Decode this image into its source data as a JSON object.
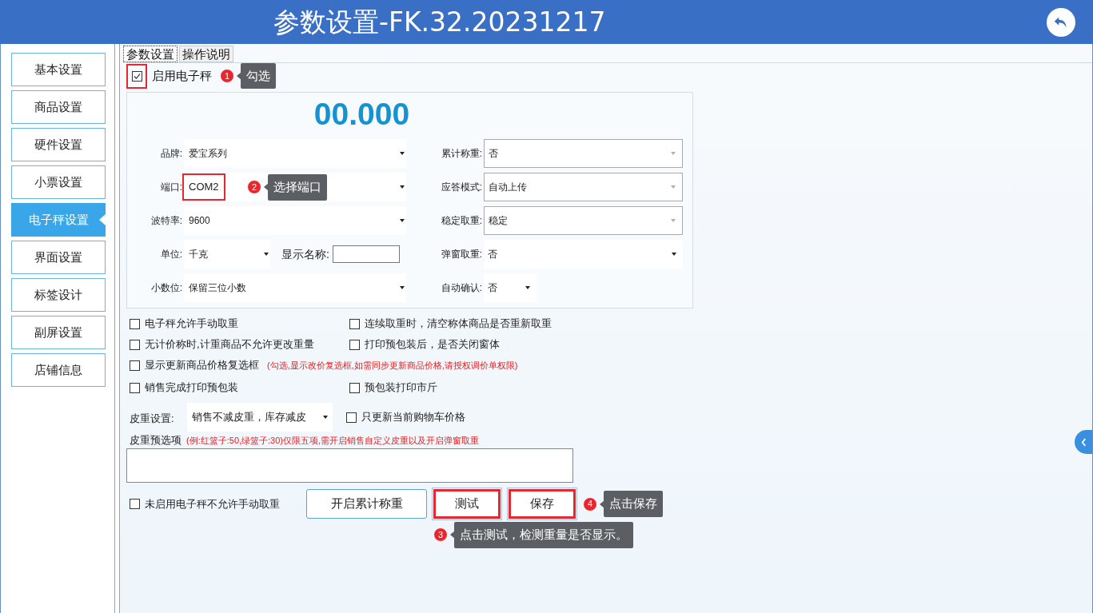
{
  "window": {
    "title": "参数设置-FK.32.20231217"
  },
  "sidebar": {
    "items": [
      {
        "label": "基本设置",
        "selected": false
      },
      {
        "label": "商品设置",
        "selected": false
      },
      {
        "label": "硬件设置",
        "selected": false
      },
      {
        "label": "小票设置",
        "selected": false
      },
      {
        "label": "电子秤设置",
        "selected": true
      },
      {
        "label": "界面设置",
        "selected": false
      },
      {
        "label": "标签设计",
        "selected": false
      },
      {
        "label": "副屏设置",
        "selected": false
      },
      {
        "label": "店铺信息",
        "selected": false
      }
    ]
  },
  "tabs": [
    {
      "label": "参数设置",
      "selected": true
    },
    {
      "label": "操作说明",
      "selected": false
    }
  ],
  "enable_scale": {
    "label": "启用电子秤",
    "checked": true,
    "highlighted": true,
    "callout": {
      "number": "1",
      "text": "勾选"
    }
  },
  "weight_display": "00.000",
  "left_fields": [
    {
      "label": "品牌:",
      "value": "爱宝系列",
      "highlighted": false
    },
    {
      "label": "端口:",
      "value": "COM2",
      "highlighted": true,
      "callout": {
        "number": "2",
        "text": "选择端口"
      }
    },
    {
      "label": "波特率:",
      "value": "9600",
      "highlighted": false
    }
  ],
  "unit_field": {
    "label": "单位:",
    "value": "千克"
  },
  "display_name": {
    "label": "显示名称:"
  },
  "decimal_field": {
    "label": "小数位:",
    "value": "保留三位小数"
  },
  "right_fields": [
    {
      "label": "累计称重:",
      "value": "否",
      "kind": "boxed"
    },
    {
      "label": "应答模式:",
      "value": "自动上传",
      "kind": "boxed"
    },
    {
      "label": "稳定取重:",
      "value": "稳定",
      "kind": "boxed"
    },
    {
      "label": "弹窗取重:",
      "value": "否",
      "kind": "flat"
    },
    {
      "label": "自动确认:",
      "value": "否",
      "kind": "short"
    }
  ],
  "options_left": [
    {
      "label": "电子秤允许手动取重",
      "checked": false
    },
    {
      "label": "无计价称时,计重商品不允许更改重量",
      "checked": false
    },
    {
      "label": "显示更新商品价格复选框",
      "checked": false,
      "note": "(勾选,显示改价复选框,如需同步更新商品价格,请授权调价单权限)"
    },
    {
      "label": "销售完成打印预包装",
      "checked": false
    }
  ],
  "options_right": [
    {
      "label": "连续取重时，清空称体商品是否重新取重",
      "checked": false
    },
    {
      "label": "打印预包装后，是否关闭窗体",
      "checked": false
    },
    {
      "label": "预包装打印市斤",
      "checked": false
    }
  ],
  "tare_setting": {
    "label": "皮重设置:",
    "value": "销售不减皮重，库存减皮"
  },
  "cart_option": {
    "label": "只更新当前购物车价格",
    "checked": false
  },
  "tare_presets": {
    "label": "皮重预选项",
    "note": "(例:红篮子:50,绿篮子:30)仅限五项,需开启销售自定义皮重以及开启弹窗取重"
  },
  "manual_option": {
    "label": "未启用电子秤不允许手动取重",
    "checked": false
  },
  "buttons": [
    {
      "label": "开启累计称重",
      "highlighted": false
    },
    {
      "label": "测试",
      "highlighted": true,
      "callout": {
        "number": "3",
        "text": "点击测试，检测重量是否显示。"
      }
    },
    {
      "label": "保存",
      "highlighted": true,
      "callout": {
        "number": "4",
        "text": "点击保存"
      }
    }
  ]
}
